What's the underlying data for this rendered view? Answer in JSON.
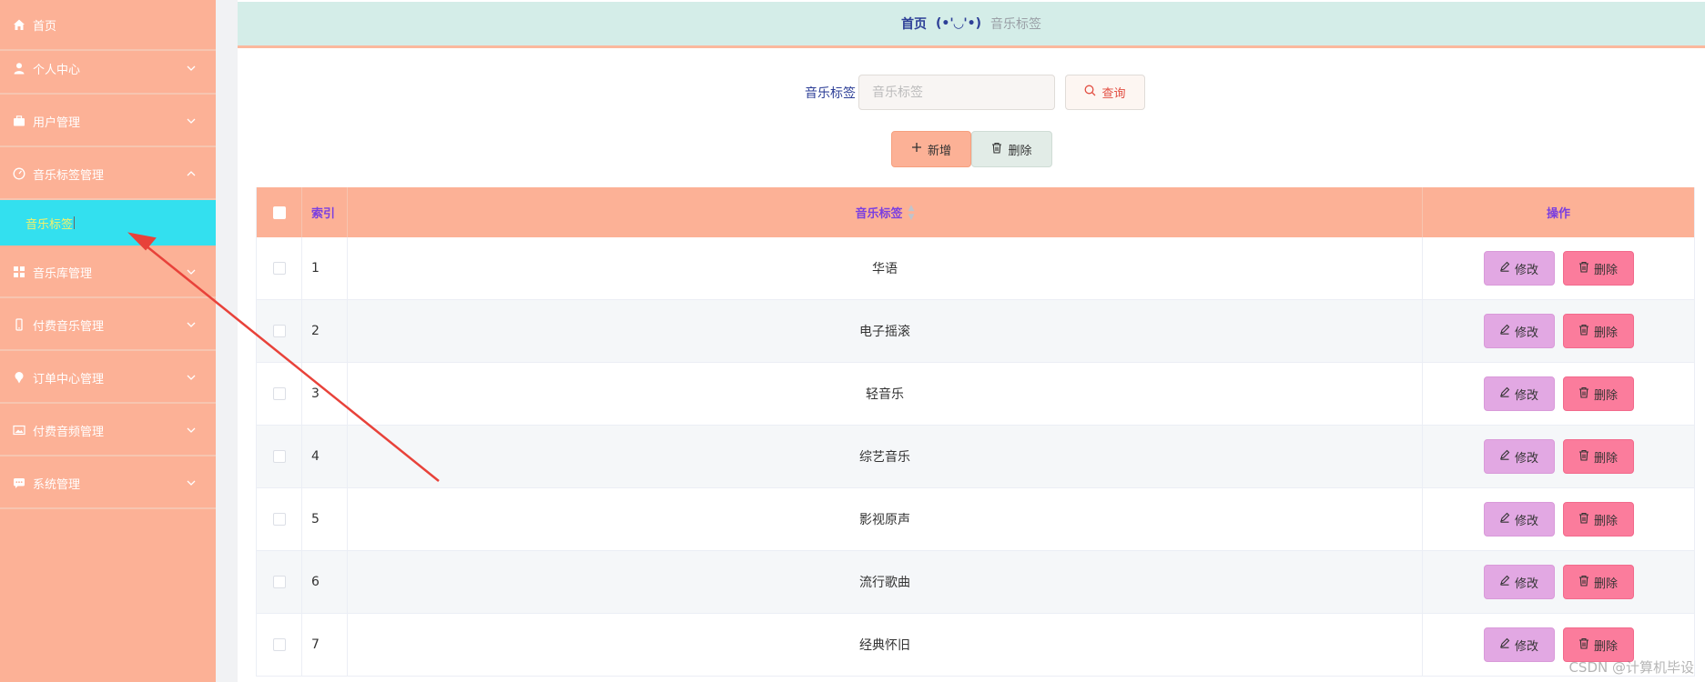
{
  "sidebar": {
    "items": [
      {
        "label": "首页",
        "icon": "home-icon",
        "has_chevron": false
      },
      {
        "label": "个人中心",
        "icon": "user-icon",
        "has_chevron": true
      },
      {
        "label": "用户管理",
        "icon": "briefcase-icon",
        "has_chevron": true
      },
      {
        "label": "音乐标签管理",
        "icon": "dashboard-icon",
        "has_chevron": true,
        "expanded": true
      },
      {
        "label": "音乐库管理",
        "icon": "grid-icon",
        "has_chevron": true
      },
      {
        "label": "付费音乐管理",
        "icon": "phone-icon",
        "has_chevron": true
      },
      {
        "label": "订单中心管理",
        "icon": "pin-icon",
        "has_chevron": true
      },
      {
        "label": "付费音频管理",
        "icon": "picture-icon",
        "has_chevron": true
      },
      {
        "label": "系统管理",
        "icon": "chat-icon",
        "has_chevron": true
      }
    ],
    "sub_item": {
      "label": "音乐标签"
    }
  },
  "breadcrumb": {
    "home": "首页",
    "separator": "(•'◡'•)",
    "current": "音乐标签"
  },
  "search": {
    "label": "音乐标签",
    "placeholder": "音乐标签",
    "query_label": "查询"
  },
  "actions": {
    "add_label": "新增",
    "delete_label": "删除"
  },
  "table": {
    "headers": {
      "index": "索引",
      "tag": "音乐标签",
      "op": "操作"
    },
    "rows": [
      {
        "index": "1",
        "tag": "华语"
      },
      {
        "index": "2",
        "tag": "电子摇滚"
      },
      {
        "index": "3",
        "tag": "轻音乐"
      },
      {
        "index": "4",
        "tag": "综艺音乐"
      },
      {
        "index": "5",
        "tag": "影视原声"
      },
      {
        "index": "6",
        "tag": "流行歌曲"
      },
      {
        "index": "7",
        "tag": "经典怀旧"
      }
    ],
    "edit_label": "修改",
    "remove_label": "删除"
  },
  "watermark": "CSDN @计算机毕设",
  "colors": {
    "sidebar_bg": "#fcb196",
    "active_sub_bg": "#33e0ef",
    "active_sub_text": "#f2f26b",
    "crumb_bg": "#d4ede8",
    "header_row_bg": "#fcb196",
    "edit_btn": "#e2a8e3",
    "remove_btn": "#fb7c9c",
    "annotation_arrow": "#e8423a"
  }
}
